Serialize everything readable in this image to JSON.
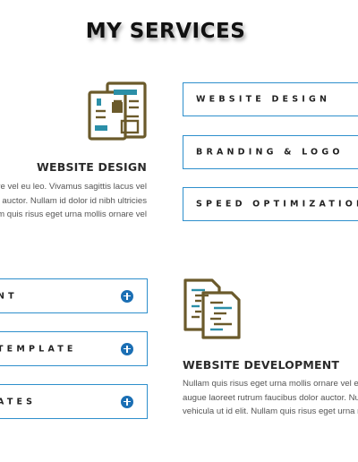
{
  "section": {
    "title": "MY SERVICES"
  },
  "services": {
    "design": {
      "icon": "newspaper-layout-icon",
      "heading": "WEBSITE DESIGN",
      "lines": [
        "are vel eu leo. Vivamus sagittis lacus vel",
        "auctor. Nullam id dolor id nibh ultricies",
        "m quis risus eget urna mollis ornare vel"
      ]
    },
    "development": {
      "icon": "code-documents-icon",
      "heading": "WEBSITE DEVELOPMENT",
      "lines": [
        "Nullam quis risus eget urna mollis ornare vel eu",
        "augue laoreet rutrum faucibus dolor auctor. Nu",
        "vehicula ut id elit. Nullam quis risus eget urna m"
      ]
    }
  },
  "menu_right": [
    "WEBSITE DESIGN",
    "BRANDING & LOGO",
    "SPEED OPTIMIZATION"
  ],
  "menu_left": [
    "NT",
    "TEMPLATE",
    "ATES"
  ],
  "icons": {
    "expand": "plus-circle-icon"
  },
  "colors": {
    "accent": "#2e8fcc",
    "icon_brown": "#6b5a2b",
    "icon_teal": "#2b8fa8",
    "plus": "#1b6fb4"
  }
}
